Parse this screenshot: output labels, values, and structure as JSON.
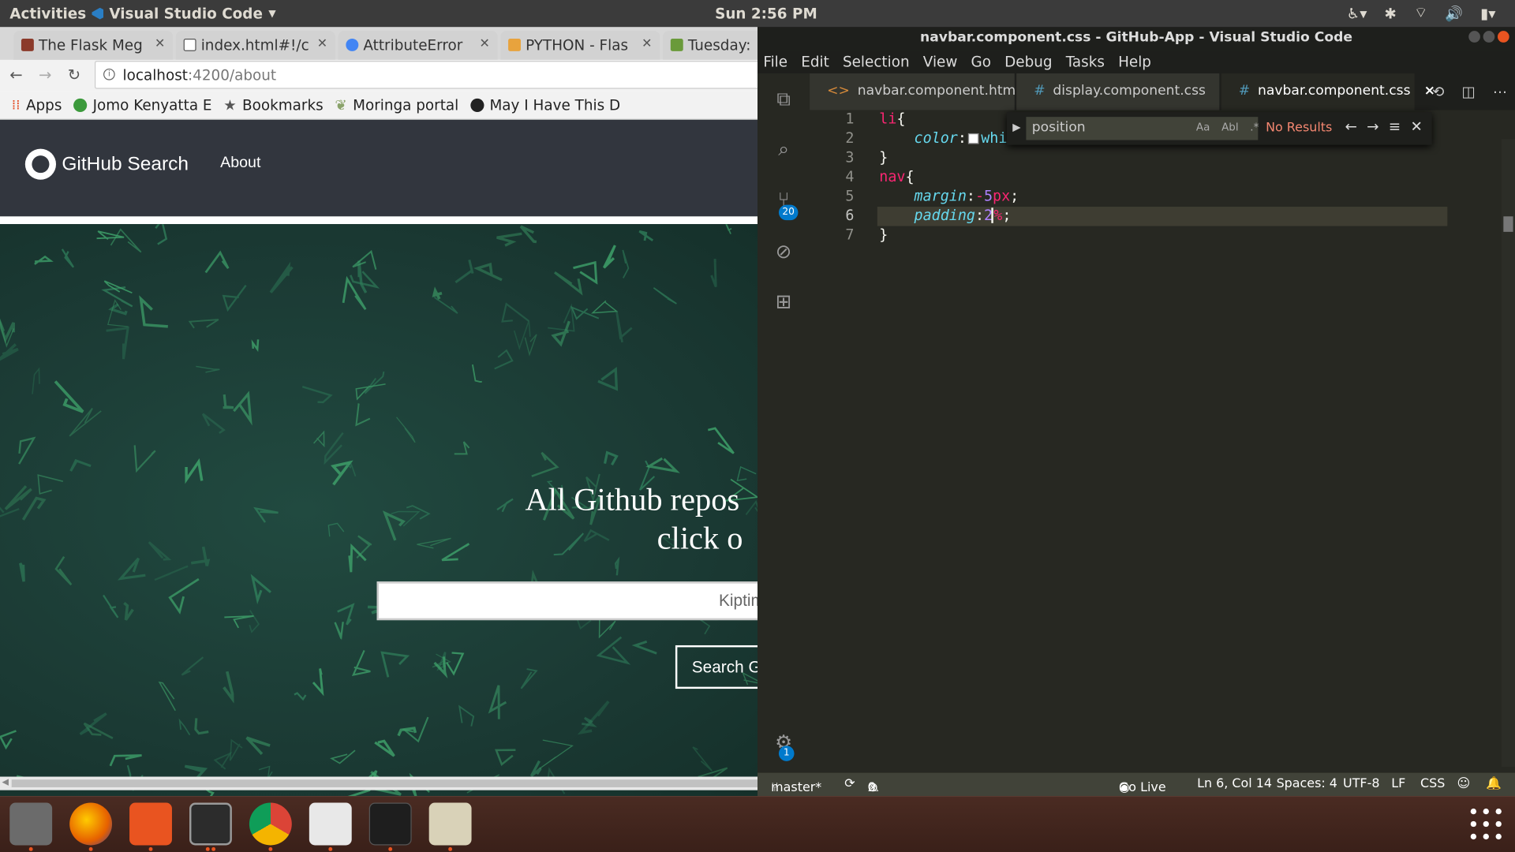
{
  "topbar": {
    "activities": "Activities",
    "app_name": "Visual Studio Code",
    "clock": "Sun  2:56 PM"
  },
  "chrome": {
    "tabs": [
      {
        "label": "The Flask Meg",
        "color": "#8b3a2a"
      },
      {
        "label": "index.html#!/c",
        "color": "#ffffff"
      },
      {
        "label": "AttributeError",
        "color": "#4285f4"
      },
      {
        "label": "PYTHON - Flas",
        "color": "#e8a33d"
      },
      {
        "label": "Tuesday:",
        "color": "#6a9a3a"
      }
    ],
    "url_host": "localhost",
    "url_path": ":4200/about",
    "bookmarks": [
      {
        "label": "Apps",
        "color": "#e44d26"
      },
      {
        "label": "Jomo Kenyatta E",
        "color": "#3c9a3c"
      },
      {
        "label": "Bookmarks",
        "color": "#555555"
      },
      {
        "label": "Moringa portal",
        "color": "#8aa36a"
      },
      {
        "label": "May I Have This D",
        "color": "#222222"
      }
    ]
  },
  "page": {
    "brand": "GitHub Search",
    "nav_about": "About",
    "heading_line1": "All Github repos",
    "heading_line2": "click o",
    "search_placeholder": "Kiptim",
    "search_button": "Search G"
  },
  "vscode": {
    "title": "navbar.component.css - GitHub-App - Visual Studio Code",
    "menu": [
      "File",
      "Edit",
      "Selection",
      "View",
      "Go",
      "Debug",
      "Tasks",
      "Help"
    ],
    "tabs": [
      {
        "label": "navbar.component.html",
        "icon": "<>"
      },
      {
        "label": "display.component.css",
        "icon": "#"
      },
      {
        "label": "navbar.component.css",
        "icon": "#",
        "close": "×"
      }
    ],
    "scm_badge": "20",
    "settings_badge": "1",
    "line_numbers": [
      "1",
      "2",
      "3",
      "4",
      "5",
      "6",
      "7"
    ],
    "code": {
      "l1_sel": "li",
      "l1_brace": "{",
      "l2_prop": "color",
      "l2_colon": ":",
      "l2_val": "whi",
      "l3": "}",
      "l4_sel": "nav",
      "l4_brace": "{",
      "l5_prop": "margin",
      "l5_colon": ":",
      "l5_sign": "-",
      "l5_num": "5",
      "l5_unit": "px",
      "l5_semi": ";",
      "l6_prop": "padding",
      "l6_colon": ":",
      "l6_num": "2",
      "l6_unit": "%",
      "l6_semi": ";",
      "l7": "}"
    },
    "find": {
      "value": "position",
      "opt_case": "Aa",
      "opt_word": "Abl",
      "opt_regex": ".*",
      "status": "No Results"
    },
    "status": {
      "branch": "master*",
      "errors": "0",
      "warnings": "0",
      "golive": "Go Live",
      "position": "Ln 6, Col 14",
      "spaces": "Spaces: 4",
      "encoding": "UTF-8",
      "eol": "LF",
      "language": "CSS"
    }
  },
  "dock": [
    {
      "name": "files",
      "color": "#6b6b6b"
    },
    {
      "name": "firefox",
      "color": "#e66000"
    },
    {
      "name": "software",
      "color": "#e95420"
    },
    {
      "name": "terminal",
      "color": "#2c2c2c"
    },
    {
      "name": "chrome",
      "color": "#4285f4"
    },
    {
      "name": "slack",
      "color": "#e8e8e8"
    },
    {
      "name": "vscode",
      "color": "#1e1e1e"
    },
    {
      "name": "text-editor",
      "color": "#d9d2b8"
    }
  ]
}
